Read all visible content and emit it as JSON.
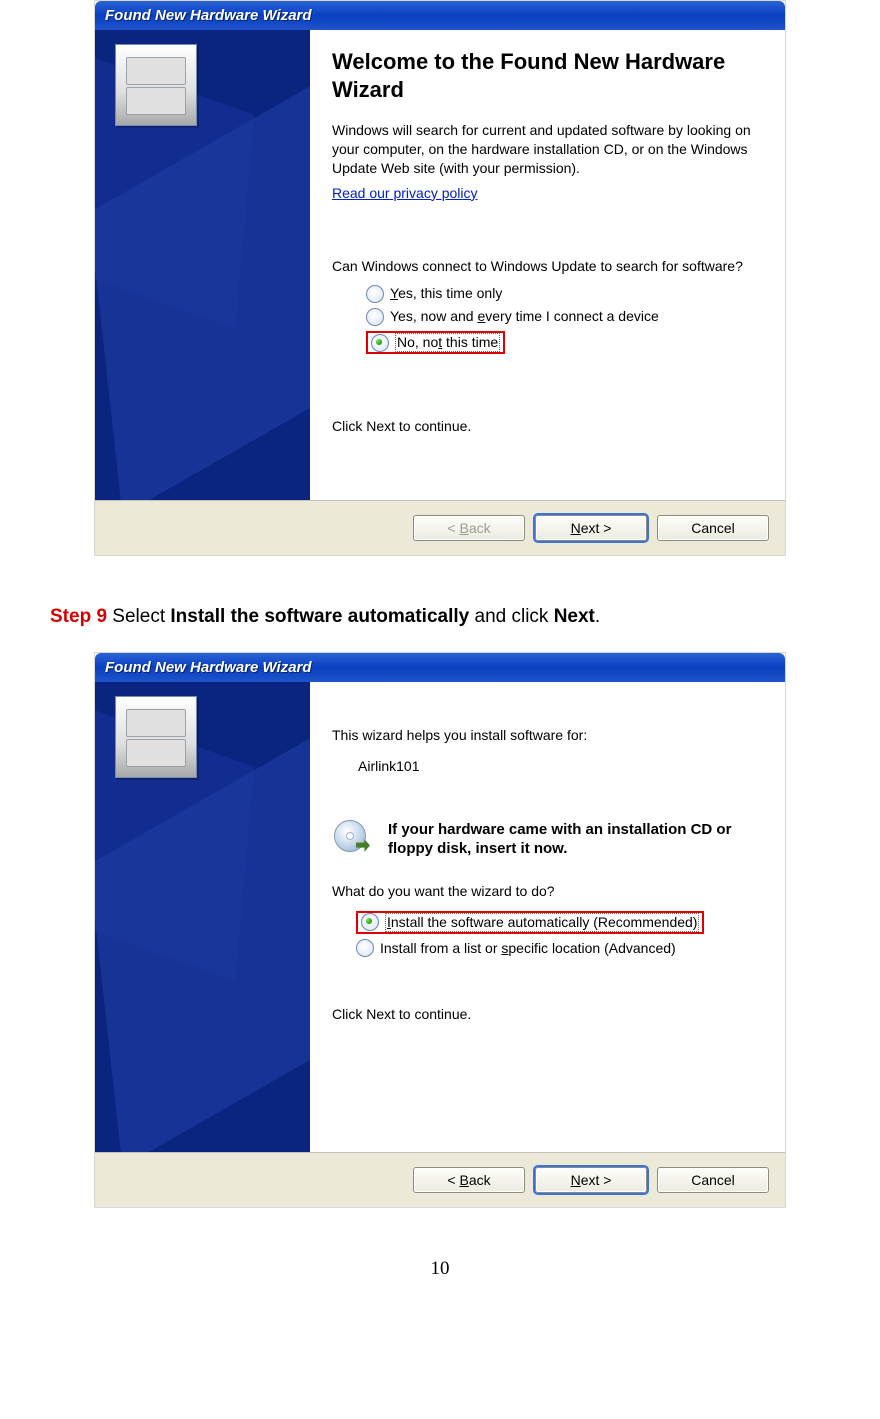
{
  "dialog1": {
    "title": "Found New Hardware Wizard",
    "heading": "Welcome to the Found New Hardware Wizard",
    "intro": "Windows will search for current and updated software by looking on your computer, on the hardware installation CD, or on the Windows Update Web site (with your permission).",
    "privacy_link": "Read our privacy policy",
    "question": "Can Windows connect to Windows Update to search for software?",
    "opt1": "Yes, this time only",
    "opt2": "Yes, now and every time I connect a device",
    "opt3": "No, not this time",
    "next_hint": "Click Next to continue.",
    "back": "< Back",
    "next": "Next >",
    "cancel": "Cancel"
  },
  "step": {
    "label": "Step 9",
    "text1": " Select ",
    "bold1": "Install the software automatically",
    "text2": " and click ",
    "bold2": "Next",
    "text3": "."
  },
  "dialog2": {
    "title": "Found New Hardware Wizard",
    "intro": "This wizard helps you install software for:",
    "device": "Airlink101",
    "cd_text": "If your hardware came with an installation CD or floppy disk, insert it now.",
    "question": "What do you want the wizard to do?",
    "opt1": "Install the software automatically (Recommended)",
    "opt2": "Install from a list or specific location (Advanced)",
    "next_hint": "Click Next to continue.",
    "back": "< Back",
    "next": "Next >",
    "cancel": "Cancel"
  },
  "page_number": "10"
}
